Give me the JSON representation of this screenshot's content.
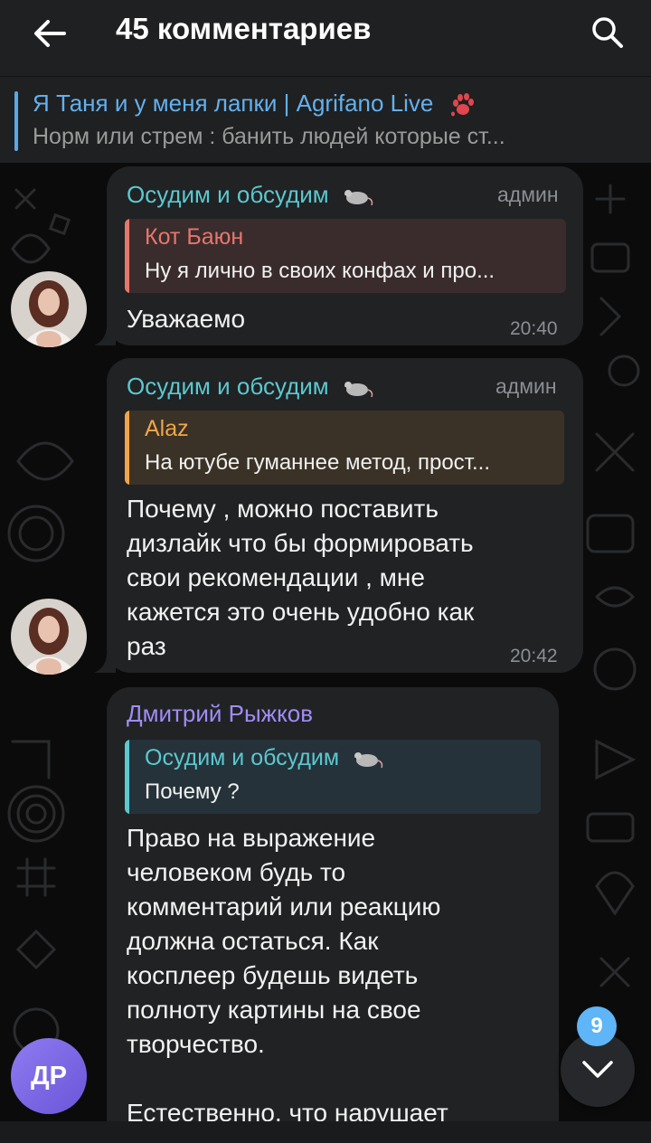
{
  "header": {
    "title": "45 комментариев"
  },
  "pinned": {
    "title": "Я Таня и у меня лапки | Agrifano Live",
    "subtitle": "Норм или стрем : банить людей которые ст..."
  },
  "messages": [
    {
      "sender": "Осудим и обсудим",
      "role": "админ",
      "reply_name": "Кот Баюн",
      "reply_text": "Ну я лично в своих конфах и про...",
      "text": "Уважаемо",
      "time": "20:40"
    },
    {
      "sender": "Осудим и обсудим",
      "role": "админ",
      "reply_name": "Alaz",
      "reply_text": "На ютубе гуманнее метод, прост...",
      "lines": [
        "Почему , можно поставить",
        "дизлайк что бы формировать",
        "свои рекомендации , мне",
        "кажется это очень удобно как",
        "раз"
      ],
      "time": "20:42"
    },
    {
      "sender": "Дмитрий Рыжков",
      "reply_name": "Осудим и обсудим",
      "reply_text": "Почему ?",
      "lines": [
        "Право на выражение",
        "человеком будь то",
        "комментарий или реакцию",
        "должна остаться. Как",
        "косплеер будешь видеть",
        "полноту картины на свое",
        "творчество.",
        "",
        "Естественно, что нарушает"
      ],
      "avatar_initials": "ДР"
    }
  ],
  "scroll": {
    "unread_count": "9"
  },
  "colors": {
    "accent": "#5eb5f7",
    "admin_name": "#5cc8cf",
    "reply_red": "#e5776d",
    "reply_orange": "#f0a54a",
    "dmitry": "#a18cf5",
    "bubble": "#202224"
  }
}
